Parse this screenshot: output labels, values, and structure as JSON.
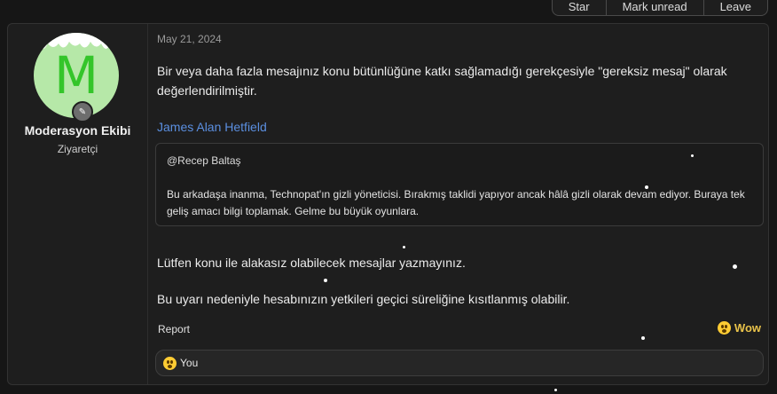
{
  "topbar": {
    "buttons": [
      "Star",
      "Mark unread",
      "Leave"
    ]
  },
  "post": {
    "user": {
      "avatar_letter": "M",
      "name": "Moderasyon Ekibi",
      "title": "Ziyaretçi"
    },
    "date": "May 21, 2024",
    "paragraph1": "Bir veya daha fazla mesajınız konu bütünlüğüne katkı sağlamadığı gerekçesiyle \"gereksiz mesaj\" olarak değerlendirilmiştir.",
    "quoted_author": "James Alan Hetfield",
    "quote": {
      "header": "@Recep Baltaş",
      "body": "Bu arkadaşa inanma, Technopat'ın gizli yöneticisi. Bırakmış taklidi yapıyor ancak hâlâ gizli olarak devam ediyor. Buraya tek geliş amacı bilgi toplamak. Gelme bu büyük oyunlara."
    },
    "paragraph2": "Lütfen konu ile alakasız olabilecek mesajlar yazmayınız.",
    "paragraph3": "Bu uyarı nedeniyle hesabınızın yetkileri geçici süreliğine kısıtlanmış olabilir.",
    "report_label": "Report",
    "reaction_label": "Wow",
    "reaction_summary": "You"
  },
  "colors": {
    "link": "#5b8fe0",
    "reaction": "#e8c24a",
    "avatar_bg": "#b6e8a8",
    "avatar_letter": "#34c52a"
  }
}
